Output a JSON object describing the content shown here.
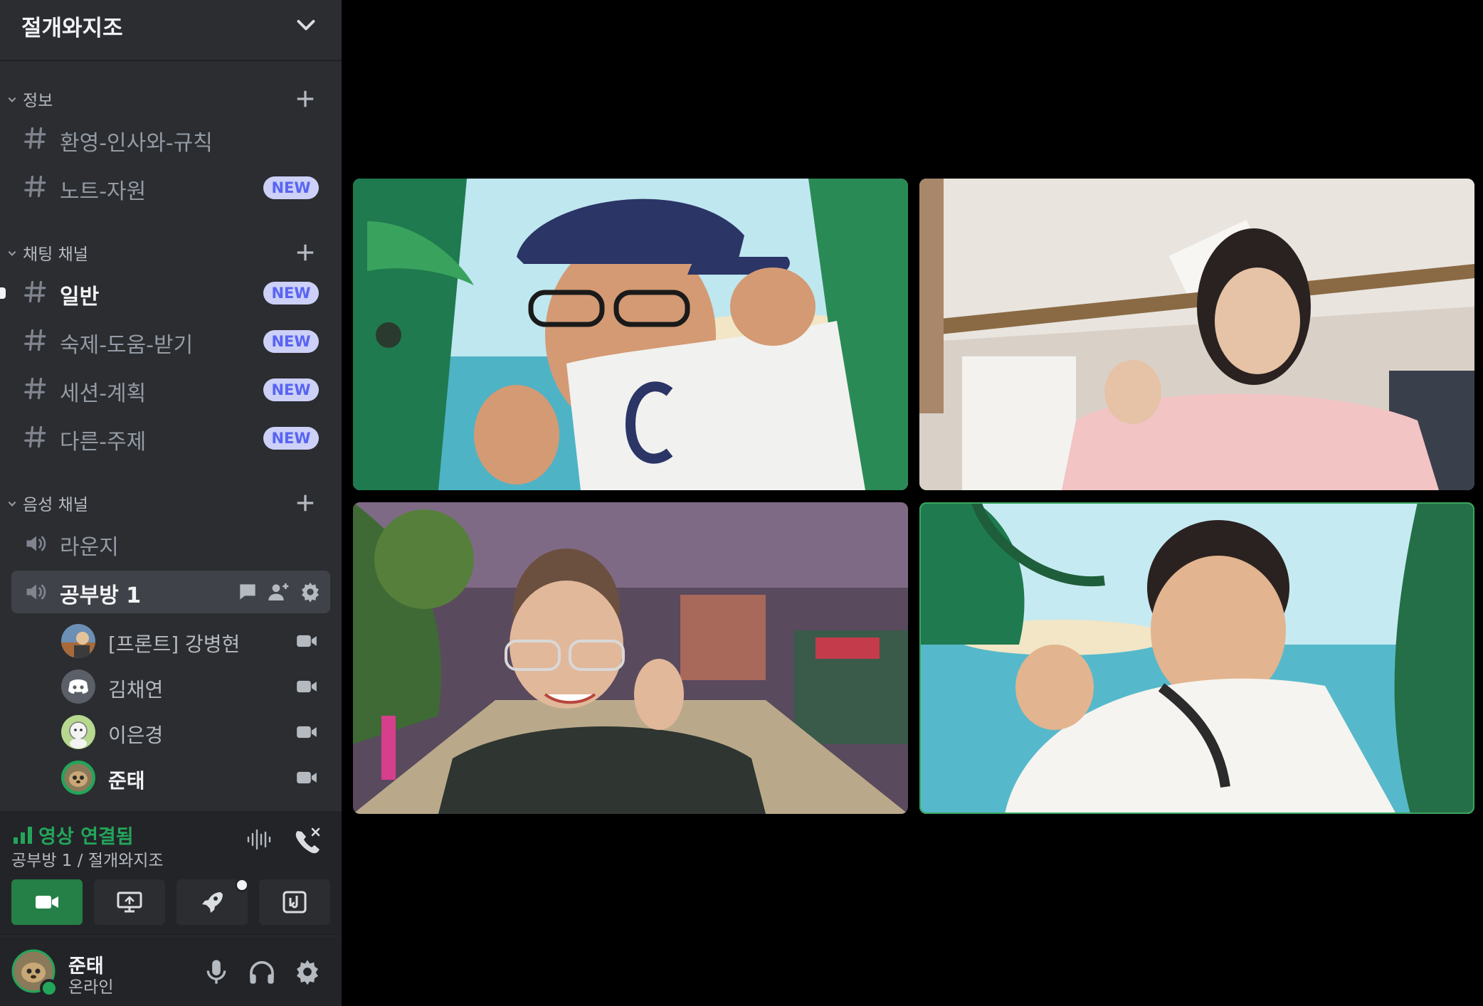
{
  "server": {
    "name": "절개와지조"
  },
  "categories": [
    {
      "label": "정보"
    },
    {
      "label": "채팅 채널"
    },
    {
      "label": "음성 채널"
    }
  ],
  "text_channels": [
    {
      "name": "환영-인사와-규칙",
      "badge": ""
    },
    {
      "name": "노트-자원",
      "badge": "NEW"
    },
    {
      "name": "일반",
      "badge": "NEW"
    },
    {
      "name": "숙제-도움-받기",
      "badge": "NEW"
    },
    {
      "name": "세션-계획",
      "badge": "NEW"
    },
    {
      "name": "다른-주제",
      "badge": "NEW"
    }
  ],
  "voice_channels": [
    {
      "name": "라운지"
    },
    {
      "name": "공부방 1"
    }
  ],
  "voice_members": [
    {
      "name": "[프론트] 강병현"
    },
    {
      "name": "김채연"
    },
    {
      "name": "이은경"
    },
    {
      "name": "준태"
    }
  ],
  "voice_panel": {
    "status": "영상 연결됨",
    "location": "공부방 1 / 절개와지조"
  },
  "user": {
    "name": "준태",
    "status": "온라인"
  },
  "colors": {
    "sidebar": "#2b2d31",
    "panel": "#232428",
    "connected_green": "#23a55a",
    "new_badge_bg": "#cdd0f7",
    "new_badge_text": "#5865f2"
  },
  "icons": [
    "chevron-down-icon",
    "plus-icon",
    "hash-icon",
    "speaker-icon",
    "chat-icon",
    "add-person-icon",
    "gear-icon",
    "camera-icon",
    "signal-icon",
    "soundwave-icon",
    "disconnect-icon",
    "screen-share-icon",
    "rocket-icon",
    "soundboard-icon",
    "microphone-icon",
    "headphones-icon"
  ]
}
